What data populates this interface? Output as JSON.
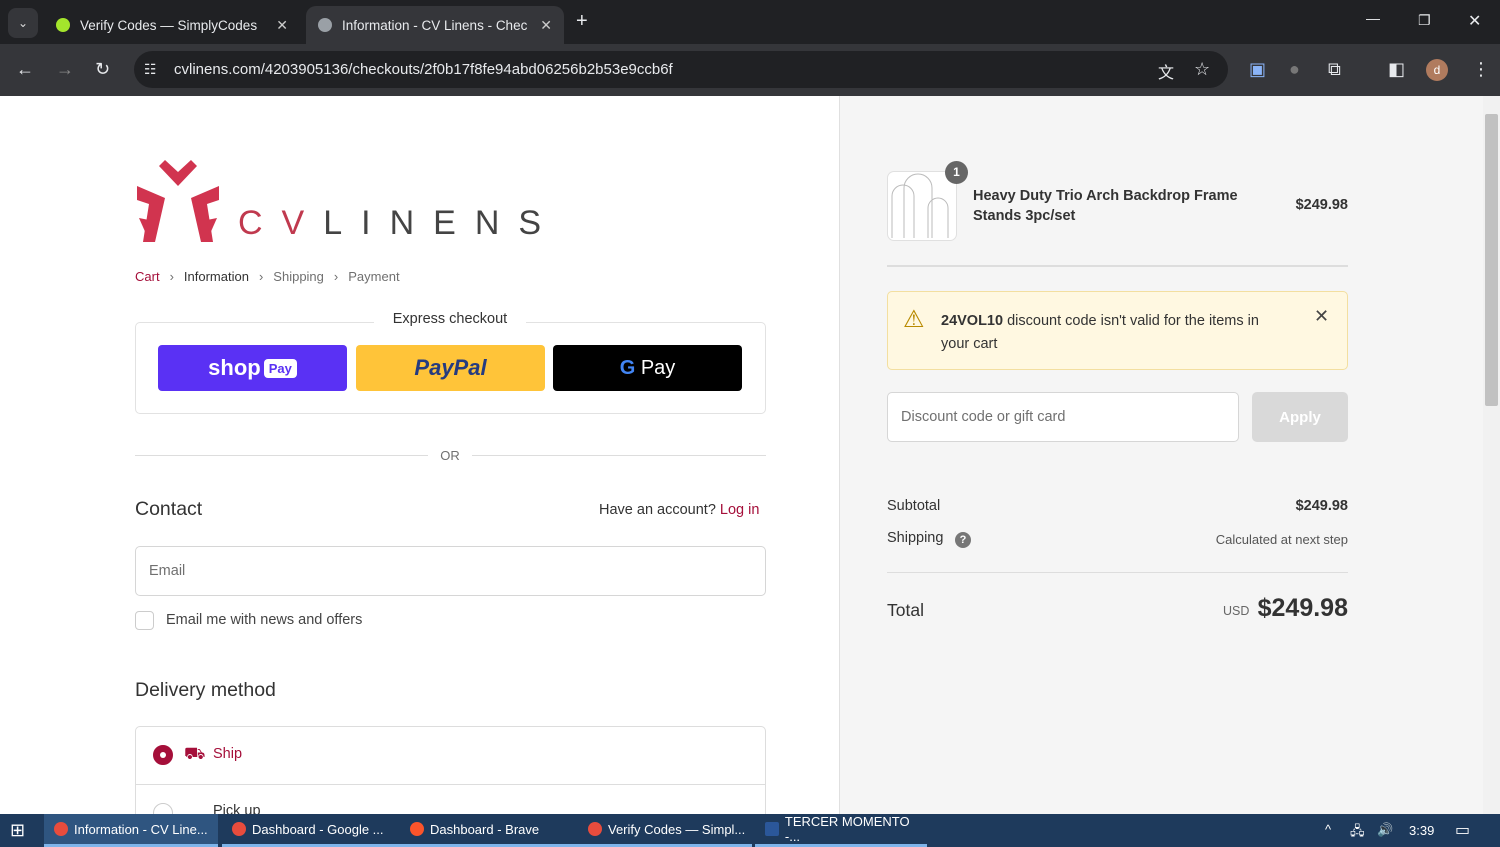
{
  "browser": {
    "tabs": [
      {
        "title": "Verify Codes — SimplyCodes"
      },
      {
        "title": "Information - CV Linens - Check"
      }
    ],
    "url": "cvlinens.com/4203905136/checkouts/2f0b17f8fe94abd06256b2b53e9ccb6f",
    "profile_initial": "d"
  },
  "logo": {
    "text": "CVLINENS"
  },
  "breadcrumb": [
    "Cart",
    "Information",
    "Shipping",
    "Payment"
  ],
  "express": {
    "title": "Express checkout",
    "shop": "shop",
    "shop_pay": "Pay",
    "paypal": "PayPal",
    "gpay": "Pay",
    "or": "OR"
  },
  "contact": {
    "title": "Contact",
    "have_account": "Have an account?",
    "login": "Log in",
    "email_placeholder": "Email",
    "newsletter": "Email me with news and offers"
  },
  "delivery": {
    "title": "Delivery method",
    "options": [
      "Ship",
      "Pick up"
    ]
  },
  "summary": {
    "item": {
      "qty": "1",
      "name": "Heavy Duty Trio Arch Backdrop Frame Stands 3pc/set",
      "price": "$249.98"
    },
    "alert": {
      "code": "24VOL10",
      "message": " discount code isn't valid for the items in your cart"
    },
    "discount_placeholder": "Discount code or gift card",
    "apply": "Apply",
    "subtotal_label": "Subtotal",
    "subtotal": "$249.98",
    "shipping_label": "Shipping",
    "shipping": "Calculated at next step",
    "total_label": "Total",
    "currency": "USD",
    "total": "$249.98"
  },
  "taskbar": {
    "items": [
      "Information - CV Line...",
      "Dashboard - Google ...",
      "Dashboard - Brave",
      "Verify Codes — Simpl...",
      "TERCER MOMENTO -..."
    ],
    "time": "3:39"
  },
  "colors": {
    "accent": "#a50f3a",
    "shop": "#5a31f4",
    "paypal": "#ffc439"
  }
}
